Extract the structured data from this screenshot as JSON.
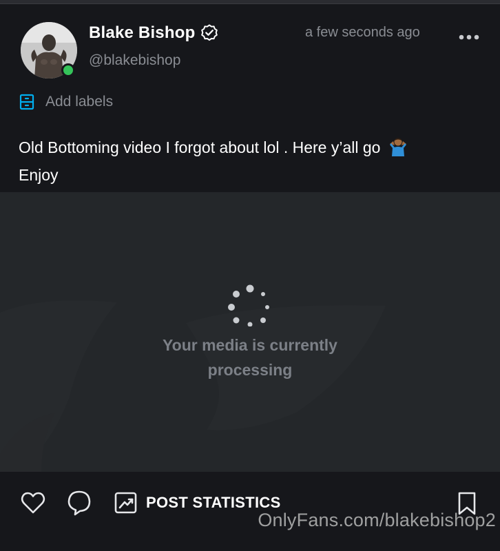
{
  "post": {
    "author": {
      "display_name": "Blake Bishop",
      "handle": "@blakebishop",
      "verified": true,
      "online": true
    },
    "timestamp": "a few seconds ago",
    "labels_action": "Add labels",
    "text_line1": "Old Bottoming video I forgot about lol . Here y’all go",
    "text_line2": "Enjoy",
    "emoji": "shrug"
  },
  "media": {
    "status_line1": "Your media is currently",
    "status_line2": "processing"
  },
  "actions": {
    "stats_label": "POST STATISTICS"
  },
  "overlay": {
    "watermark": "OnlyFans.com/blakebishop2"
  },
  "colors": {
    "background": "#16171b",
    "media_background": "#24272a",
    "muted_text": "#8a8d93",
    "accent": "#00aff0",
    "online": "#35c45a"
  },
  "icons": [
    "verified-icon",
    "more-icon",
    "labels-icon",
    "shrug-emoji-icon",
    "spinner-icon",
    "heart-icon",
    "comment-icon",
    "stats-icon",
    "bookmark-icon"
  ]
}
